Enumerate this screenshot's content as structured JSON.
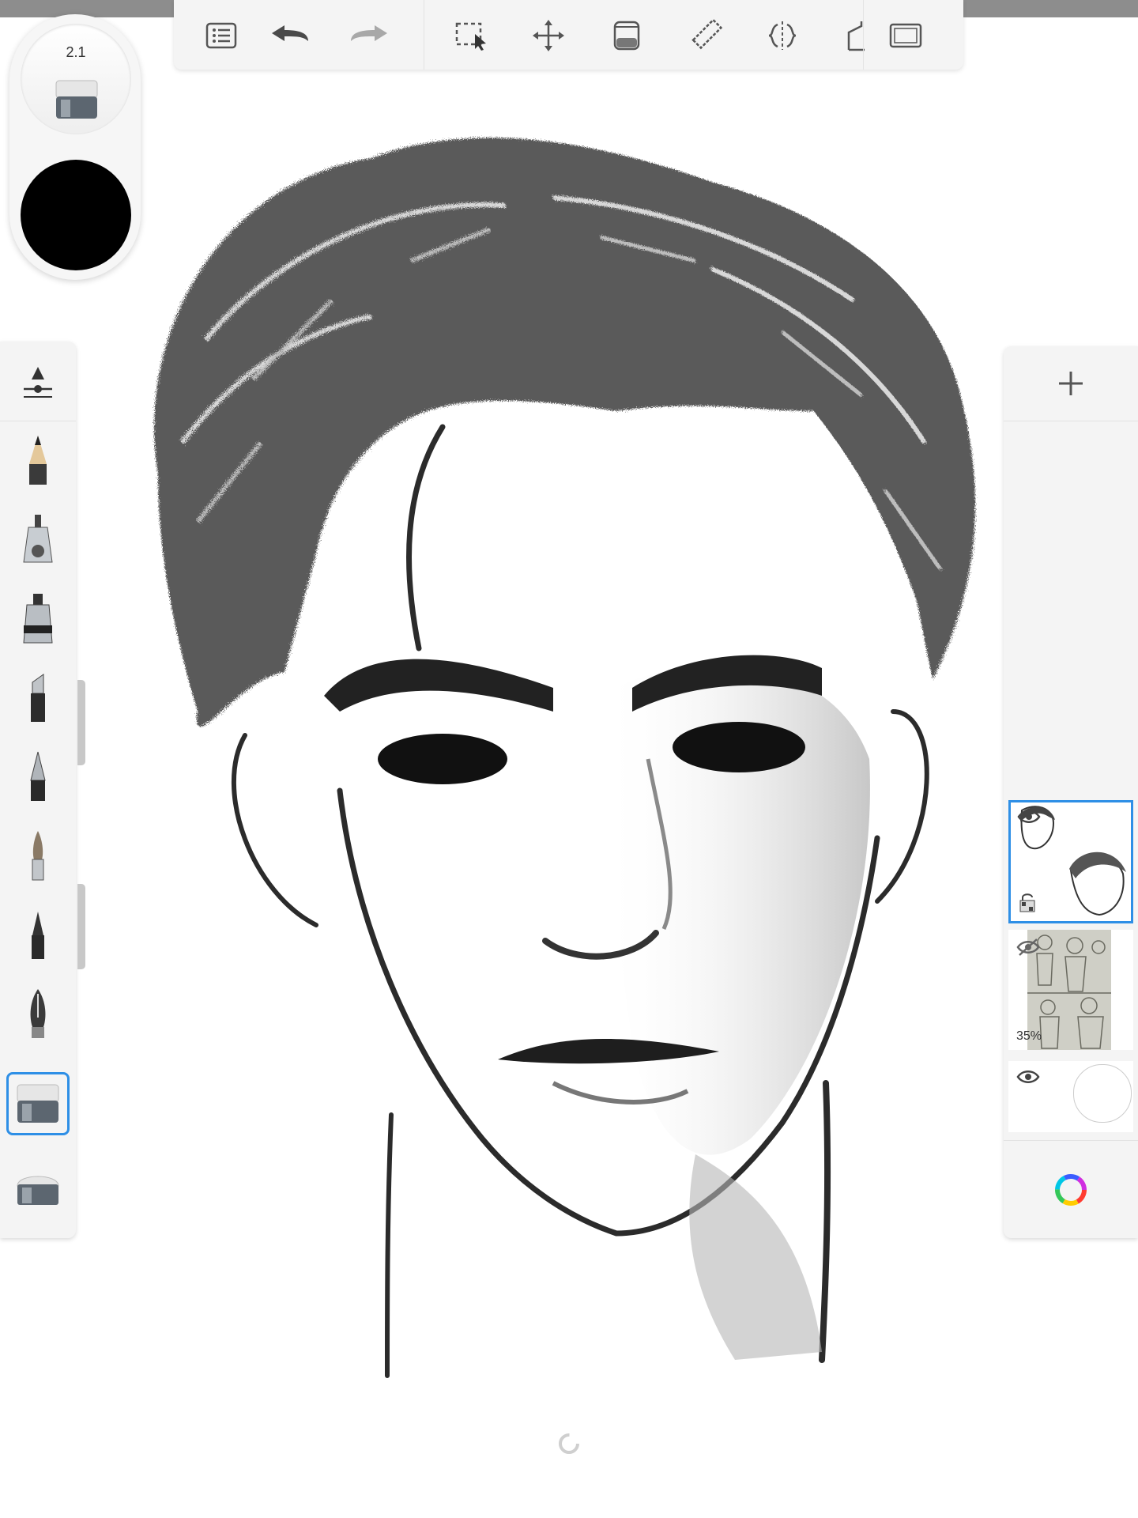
{
  "app": {
    "toolbar_icons": [
      "list-icon",
      "undo-icon",
      "redo-icon",
      "selection-icon",
      "transform-icon",
      "fill-icon",
      "ruler-icon",
      "symmetry-icon",
      "perspective-icon",
      "fullscreen-icon"
    ]
  },
  "brush_puck": {
    "size": "2.1",
    "color": "#000000"
  },
  "brush_palette": {
    "tools": [
      "pencil",
      "airbrush",
      "marker",
      "chisel-marker",
      "ballpoint-pen",
      "paintbrush",
      "fineliner",
      "fountain-pen",
      "eraser",
      "soft-eraser"
    ],
    "selected": "eraser"
  },
  "layers": {
    "items": [
      {
        "name": "layer-1",
        "visible": true,
        "active": true
      },
      {
        "name": "layer-2",
        "visible": false,
        "opacity": "35%"
      },
      {
        "name": "background",
        "visible": true
      }
    ]
  },
  "accent": "#2e8fe6"
}
